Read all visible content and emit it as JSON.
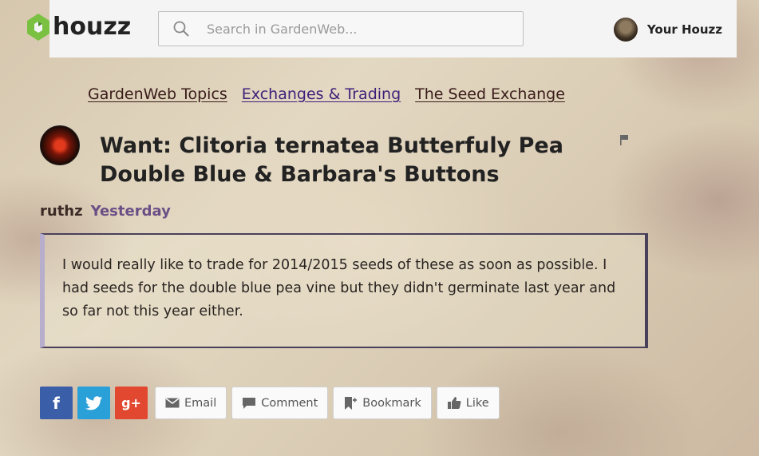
{
  "header": {
    "logo_text": "houzz",
    "search_placeholder": "Search in GardenWeb...",
    "user_label": "Your Houzz"
  },
  "breadcrumb": [
    "GardenWeb Topics",
    "Exchanges & Trading",
    "The Seed Exchange"
  ],
  "post": {
    "title": "Want: Clitoria ternatea Butterfuly Pea Double Blue & Barbara's Buttons",
    "author": "ruthz",
    "date": "Yesterday",
    "body": "I would really like to trade for 2014/2015 seeds of these as soon as possible. I had seeds for the double blue pea vine but they didn't germinate last year and so far not this year either."
  },
  "share": {
    "facebook": "f",
    "google": "g+",
    "email_label": "Email",
    "comment_label": "Comment",
    "bookmark_label": "Bookmark",
    "like_label": "Like"
  },
  "colors": {
    "facebook": "#3b5ea8",
    "twitter": "#2aa0d8",
    "google": "#e2472f",
    "houzz_green": "#7ac142"
  },
  "icons": [
    "houzz-logo-icon",
    "search-icon",
    "flag-icon",
    "twitter-icon",
    "email-icon",
    "comment-icon",
    "bookmark-icon",
    "like-icon"
  ]
}
